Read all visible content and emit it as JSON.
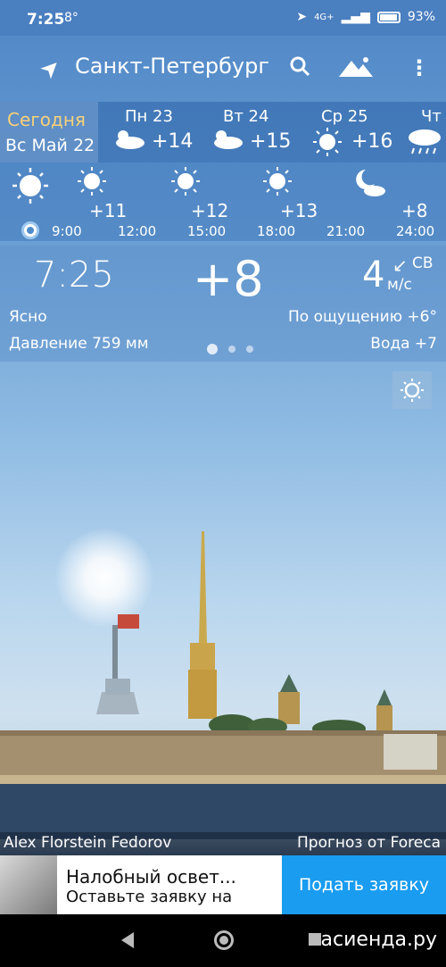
{
  "status_bar": {
    "time": "7:25",
    "temp": "8°",
    "battery": "93%",
    "network": "4G+"
  },
  "appbar": {
    "city": "Санкт-Петербург"
  },
  "days": {
    "today": {
      "label": "Сегодня",
      "date": "Вс Май 22"
    },
    "items": [
      {
        "name": "Пн 23",
        "temp": "+14",
        "icon": "cloud-sun-icon"
      },
      {
        "name": "Вт 24",
        "temp": "+15",
        "icon": "cloud-sun-icon"
      },
      {
        "name": "Ср 25",
        "temp": "+16",
        "icon": "sun-icon"
      },
      {
        "name": "Чт",
        "temp": "",
        "icon": "rain-cloud-icon"
      }
    ]
  },
  "hourly": {
    "temps": [
      "+11",
      "+12",
      "+13",
      "+8"
    ],
    "times": [
      "9:00",
      "12:00",
      "15:00",
      "18:00",
      "21:00",
      "24:00"
    ]
  },
  "current": {
    "time": "7:25",
    "temp": "+8",
    "wind_speed": "4",
    "wind_dir": "СВ",
    "wind_unit": "м/с",
    "condition": "Ясно",
    "feels_like": "По ощущению +6°",
    "pressure": "Давление 759 мм",
    "water": "Вода +7"
  },
  "credits": {
    "photo": "Alex Florstein Fedorov",
    "forecast": "Прогноз от Foreca"
  },
  "ad": {
    "title": "Налобный освет...",
    "subtitle": "Оставьте заявку на",
    "button": "Подать заявку"
  },
  "watermark": "асиенда.ру"
}
